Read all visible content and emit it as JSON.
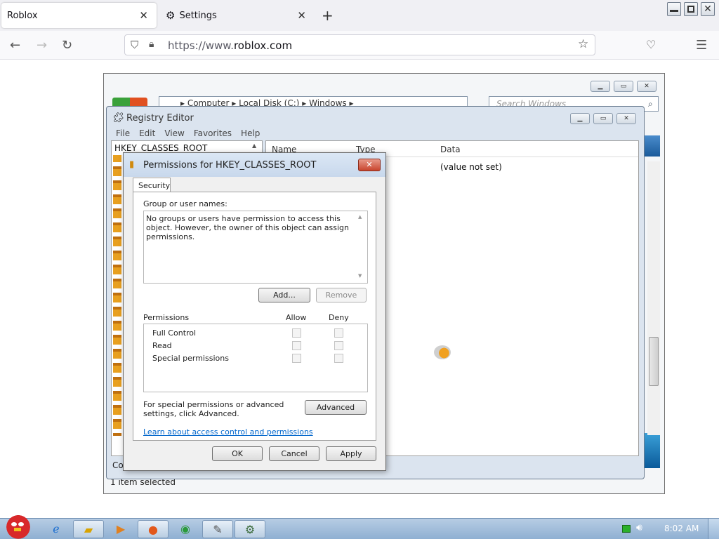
{
  "browser": {
    "tabs": [
      {
        "label": "Roblox",
        "close": "✕",
        "icon": ""
      },
      {
        "label": "Settings",
        "close": "✕",
        "icon": "gear-icon"
      }
    ],
    "new_tab": "+",
    "url_prefix": "https://www.",
    "url_domain": "roblox.com"
  },
  "explorer": {
    "breadcrumb": "▸  Computer  ▸  Local Disk (C:)  ▸  Windows  ▸",
    "search_placeholder": "Search Windows",
    "status": "1 item selected"
  },
  "regedit": {
    "title": "Registry Editor",
    "menu": [
      "File",
      "Edit",
      "View",
      "Favorites",
      "Help"
    ],
    "tree_root": "HKEY_CLASSES_ROOT",
    "columns": [
      "Name",
      "Type",
      "Data"
    ],
    "value_data": "(value not set)",
    "status_stub": "Co"
  },
  "permissions": {
    "title": "Permissions for HKEY_CLASSES_ROOT",
    "tab": "Security",
    "group_label": "Group or user names:",
    "group_message": "No groups or users have permission to access this object. However, the owner of this object can assign permissions.",
    "add_button": "Add...",
    "remove_button": "Remove",
    "permissions_label": "Permissions",
    "allow_label": "Allow",
    "deny_label": "Deny",
    "rows": [
      "Full Control",
      "Read",
      "Special permissions"
    ],
    "advanced_text": "For special permissions or advanced settings, click Advanced.",
    "advanced_button": "Advanced",
    "learn_link": "Learn about access control and permissions",
    "ok_button": "OK",
    "cancel_button": "Cancel",
    "apply_button": "Apply"
  },
  "taskbar": {
    "clock": "8:02 AM"
  }
}
